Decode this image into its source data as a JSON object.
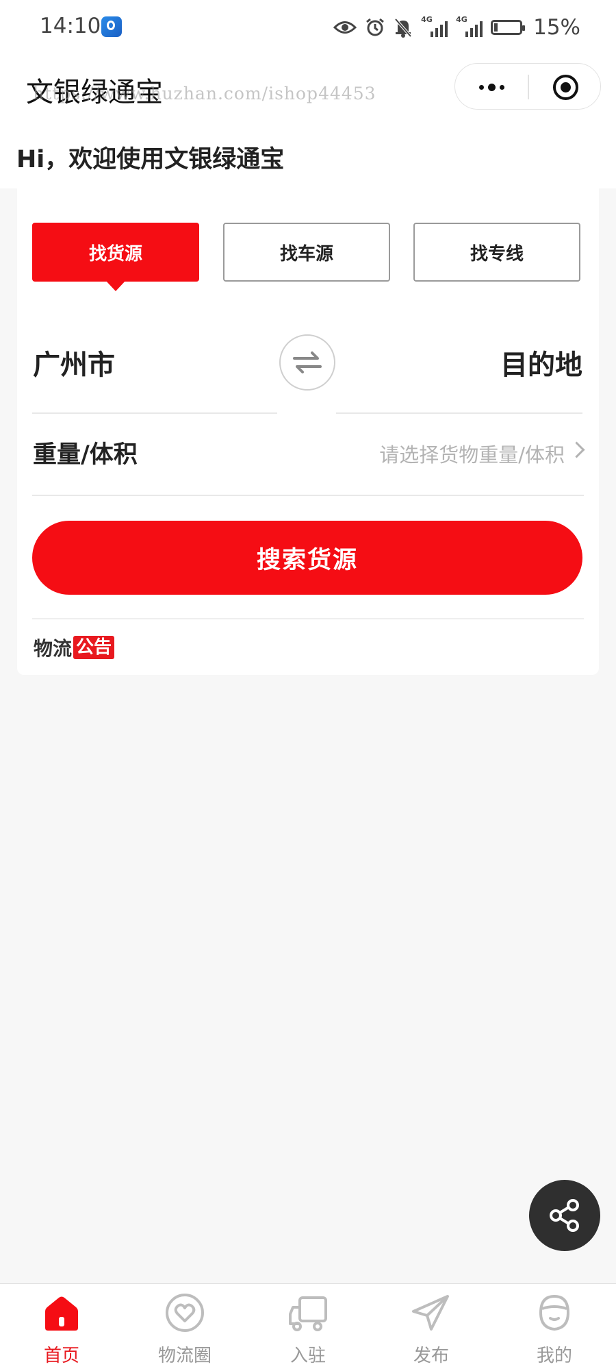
{
  "status_bar": {
    "time": "14:10",
    "battery_percent": "15%",
    "battery_level": 0.15,
    "network_1": "4G",
    "network_2": "4G",
    "icons": [
      "app-notification-icon",
      "eye-icon",
      "alarm-icon",
      "mute-bell-icon",
      "signal-icon",
      "signal-icon",
      "battery-icon"
    ]
  },
  "header": {
    "app_title": "文银绿通宝",
    "watermark": "https://www.huzhan.com/ishop44453",
    "greeting": "Hi，欢迎使用文银绿通宝",
    "capsule_icons": [
      "more-icon",
      "close-miniprogram-icon"
    ]
  },
  "search_card": {
    "tabs": [
      {
        "label": "找货源",
        "active": true
      },
      {
        "label": "找车源",
        "active": false
      },
      {
        "label": "找专线",
        "active": false
      }
    ],
    "origin": "广州市",
    "destination": "目的地",
    "swap_icon": "swap-icon",
    "weight_label": "重量/体积",
    "weight_placeholder": "请选择货物重量/体积",
    "search_button": "搜索货源",
    "notice_part1": "物流",
    "notice_part2": "公告"
  },
  "fab": {
    "icon": "share-icon"
  },
  "tab_bar": {
    "items": [
      {
        "label": "首页",
        "icon": "home-icon",
        "active": true
      },
      {
        "label": "物流圈",
        "icon": "heart-chat-icon",
        "active": false
      },
      {
        "label": "入驻",
        "icon": "truck-icon",
        "active": false
      },
      {
        "label": "发布",
        "icon": "send-icon",
        "active": false
      },
      {
        "label": "我的",
        "icon": "profile-icon",
        "active": false
      }
    ]
  },
  "colors": {
    "accent": "#f50d14",
    "background": "#f7f7f7",
    "inactive": "#999999"
  }
}
